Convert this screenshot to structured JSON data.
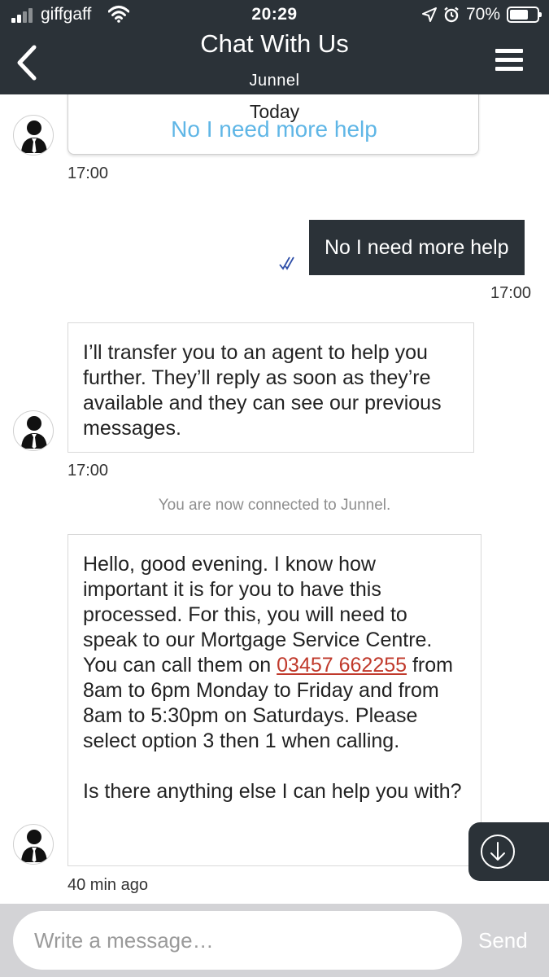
{
  "status_bar": {
    "carrier": "giffgaff",
    "time": "20:29",
    "battery": "70%",
    "battery_level": 0.7
  },
  "header": {
    "title": "Chat With Us",
    "agent_name": "Junnel"
  },
  "chat": {
    "date_divider": "Today",
    "top_button_label": "No I need more help",
    "top_time": "17:00",
    "user_message": "No I need more help",
    "user_time": "17:00",
    "bot_transfer_message": "I’ll transfer you to an agent to help you further. They’ll reply as soon as they’re available and they can see our previous messages.",
    "bot_transfer_time": "17:00",
    "system_message": "You are now connected to Junnel.",
    "agent_message_part1": "Hello, good evening. I know how important it is for you to have this processed. For this, you will need to speak to our Mortgage Service Centre. You can call them on",
    "agent_phone": "03457 662255",
    "agent_message_part2": "from 8am to 6pm Monday to Friday and from 8am to 5:30pm on Saturdays. Please select option 3 then 1 when calling.",
    "agent_message_part3": "Is there anything else I can help you with?",
    "agent_time": "40 min ago"
  },
  "composer": {
    "placeholder": "Write a message…",
    "send_label": "Send"
  },
  "colors": {
    "header_bg": "#2b3238",
    "link_blue": "#5fb6e6",
    "phone_red": "#c0392b",
    "composer_bg": "#d3d3d6"
  }
}
